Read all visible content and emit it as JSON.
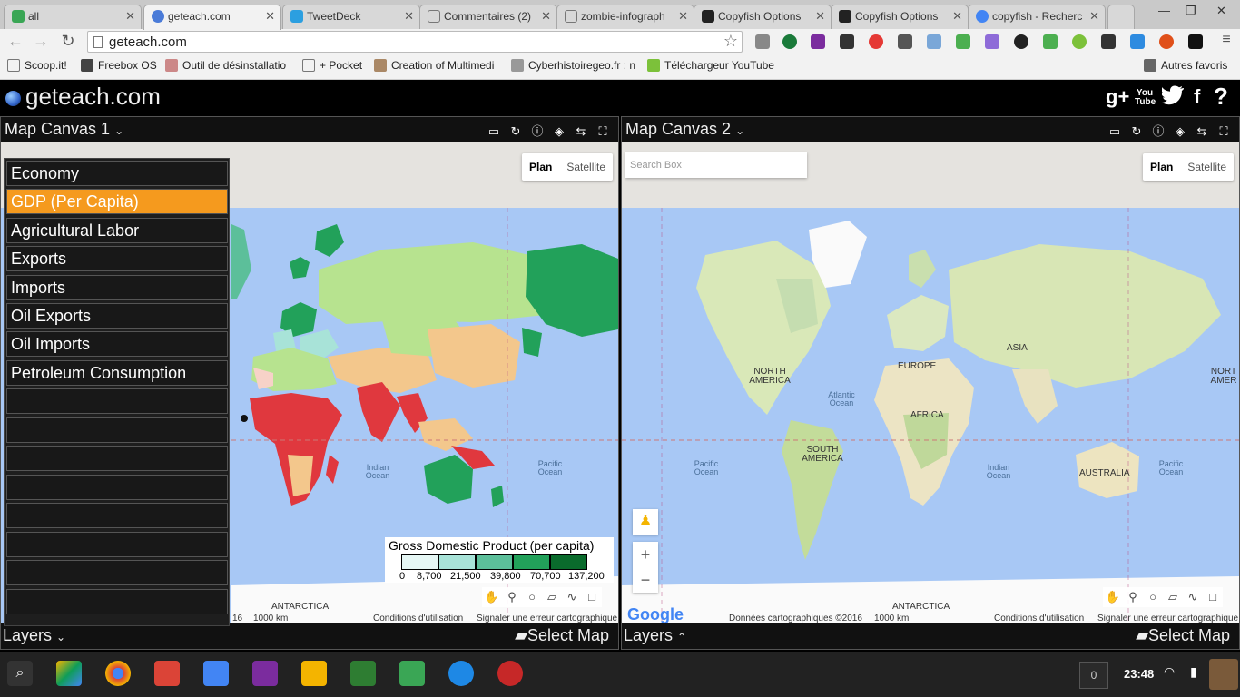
{
  "browser": {
    "tabs": [
      {
        "title": "all",
        "color": "#3aa655"
      },
      {
        "title": "geteach.com",
        "color": "#4a7bd8",
        "active": true
      },
      {
        "title": "TweetDeck",
        "color": "#2c9fe0"
      },
      {
        "title": "Commentaires (2)",
        "color": "#888888"
      },
      {
        "title": "zombie-infograph",
        "color": "#888888"
      },
      {
        "title": "Copyfish Options",
        "color": "#222222"
      },
      {
        "title": "Copyfish Options",
        "color": "#222222"
      },
      {
        "title": "copyfish - Recherc",
        "color": "#4285f4"
      }
    ],
    "url": "geteach.com",
    "bookmarks": [
      "Scoop.it!",
      "Freebox OS",
      "Outil de désinstallatio",
      "+ Pocket",
      "Creation of Multimedi",
      "Cyberhistoiregeo.fr : n",
      "Téléchargeur YouTube"
    ],
    "other_bookmarks": "Autres favoris"
  },
  "app": {
    "logo": "geteach.com",
    "social": [
      "g+",
      "You Tube",
      "twitter",
      "f",
      "?"
    ]
  },
  "canvas1": {
    "title": "Map Canvas 1",
    "map_type_plan": "Plan",
    "map_type_satellite": "Satellite",
    "layers_label": "Layers",
    "select_map_label": "Select Map",
    "attr_scale": "1000 km",
    "attr_terms": "Conditions d'utilisation",
    "attr_report": "Signaler une erreur cartographique",
    "attr_year": "16",
    "antarctica": "ANTARCTICA",
    "indian_ocean": "Indian Ocean",
    "pacific_ocean": "Pacific Ocean"
  },
  "menu": {
    "items": [
      "Economy",
      "GDP (Per Capita)",
      "Agricultural Labor",
      "Exports",
      "Imports",
      "Oil Exports",
      "Oil Imports",
      "Petroleum Consumption",
      "",
      "",
      "",
      "",
      "",
      "",
      "",
      ""
    ],
    "active_index": 1
  },
  "legend": {
    "title": "Gross Domestic Product (per capita)",
    "breaks": [
      "0",
      "8,700",
      "21,500",
      "39,800",
      "70,700",
      "137,200"
    ],
    "colors": [
      "#e6f7f5",
      "#a8e3d8",
      "#5cbf9a",
      "#22a15a",
      "#0a6b2c"
    ]
  },
  "canvas2": {
    "title": "Map Canvas 2",
    "search_placeholder": "Search Box",
    "map_type_plan": "Plan",
    "map_type_satellite": "Satellite",
    "layers_label": "Layers",
    "select_map_label": "Select Map",
    "google": "Google",
    "attr_data": "Données cartographiques ©2016",
    "attr_scale": "1000 km",
    "attr_terms": "Conditions d'utilisation",
    "attr_report": "Signaler une erreur cartographique",
    "zoom_in": "+",
    "zoom_out": "−",
    "labels": {
      "north_america": "NORTH AMERICA",
      "south_america": "SOUTH AMERICA",
      "europe": "EUROPE",
      "africa": "AFRICA",
      "asia": "ASIA",
      "australia": "AUSTRALIA",
      "antarctica": "ANTARCTICA",
      "atlantic": "Atlantic Ocean",
      "pacific_left": "Pacific Ocean",
      "pacific_right": "Pacific Ocean",
      "indian": "Indian Ocean",
      "north_america_right": "NORT AMER"
    }
  },
  "taskbar": {
    "counter": "0",
    "clock": "23:48"
  }
}
